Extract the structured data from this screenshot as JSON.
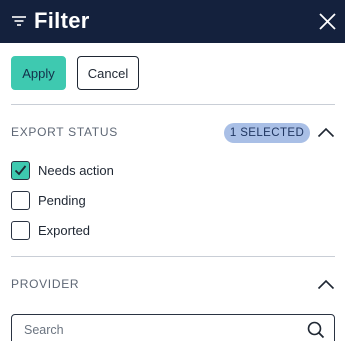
{
  "header": {
    "title": "Filter",
    "icon": "filter-lines-icon",
    "close_icon": "close-icon",
    "background": "#14213d"
  },
  "actions": {
    "apply_label": "Apply",
    "cancel_label": "Cancel",
    "apply_color": "#3ec9b0"
  },
  "export_status": {
    "title": "EXPORT STATUS",
    "badge": "1 SELECTED",
    "badge_color": "#a9bfe6",
    "expanded": true,
    "options": [
      {
        "label": "Needs action",
        "checked": true
      },
      {
        "label": "Pending",
        "checked": false
      },
      {
        "label": "Exported",
        "checked": false
      }
    ]
  },
  "provider": {
    "title": "PROVIDER",
    "expanded": true,
    "search_placeholder": "Search",
    "search_value": ""
  }
}
